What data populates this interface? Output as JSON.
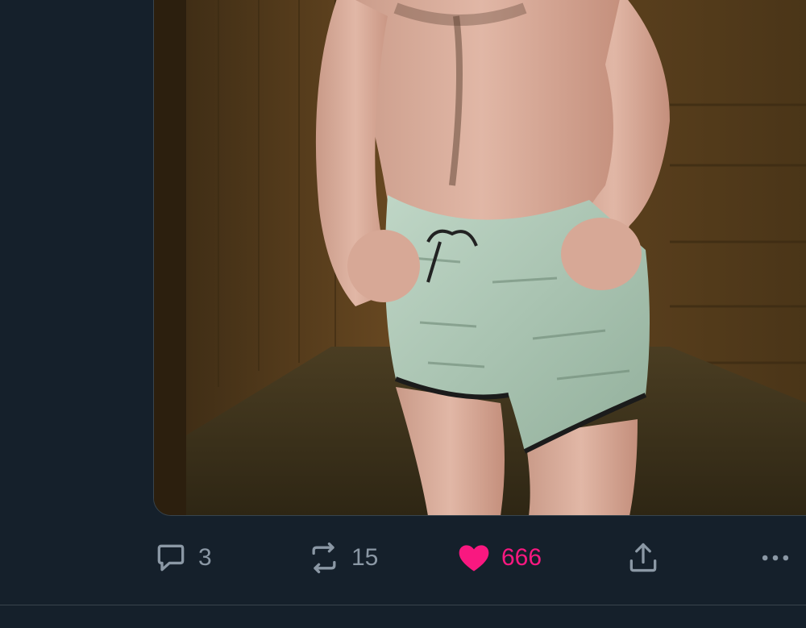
{
  "tweet": {
    "media": {
      "kind": "photo"
    },
    "actions": {
      "reply_count": "3",
      "retweet_count": "15",
      "like_count": "666",
      "liked": true
    }
  },
  "colors": {
    "background": "#15202b",
    "icon_gray": "#8b98a5",
    "like_pink": "#f91880",
    "border": "#38444d"
  },
  "icons": {
    "reply": "reply-icon",
    "retweet": "retweet-icon",
    "like": "heart-icon",
    "share": "share-icon",
    "more": "more-icon"
  }
}
